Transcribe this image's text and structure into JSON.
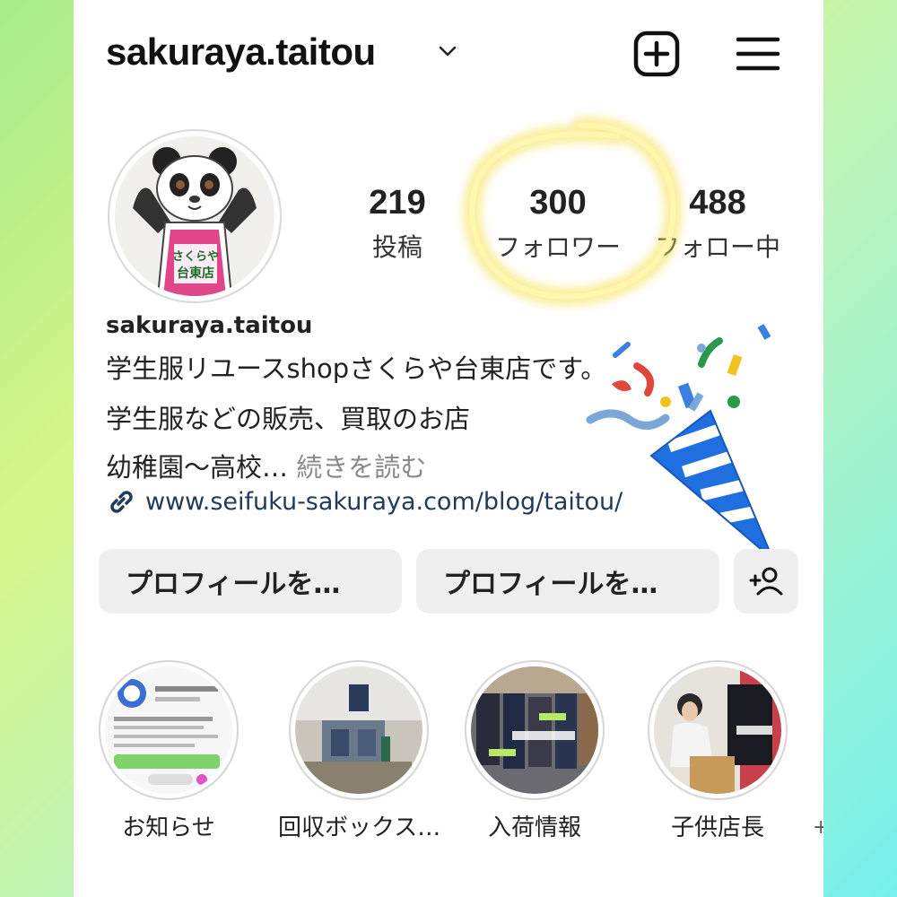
{
  "header": {
    "username": "sakuraya.taitou"
  },
  "stats": {
    "posts": {
      "value": "219",
      "label": "投稿"
    },
    "followers": {
      "value": "300",
      "label": "フォロワー"
    },
    "following": {
      "value": "488",
      "label": "フォロー中"
    }
  },
  "avatar": {
    "apron_text_1": "さくらや",
    "apron_text_2": "台東店"
  },
  "bio": {
    "name": "sakuraya.taitou",
    "line1": "学生服リユースshopさくらや台東店です。",
    "line2": "学生服などの販売、買取のお店",
    "line3": "幼稚園〜高校…",
    "more": "続きを読む",
    "link": "www.seifuku-sakuraya.com/blog/taitou/"
  },
  "buttons": {
    "edit_profile": "プロフィールを…",
    "share_profile": "プロフィールを…"
  },
  "highlights": [
    {
      "label": "お知らせ"
    },
    {
      "label": "回収ボックス…"
    },
    {
      "label": "入荷情報"
    },
    {
      "label": "子供店長"
    }
  ],
  "icons": {
    "chevron": "chevron-down-icon",
    "add": "add-post-icon",
    "menu": "menu-icon",
    "link": "link-icon",
    "add_person": "add-person-icon"
  },
  "colors": {
    "highlight_ring": "#f7df4a",
    "apron": "#e0468a",
    "link_text": "#1f3a5a",
    "button_bg": "#efefef"
  }
}
